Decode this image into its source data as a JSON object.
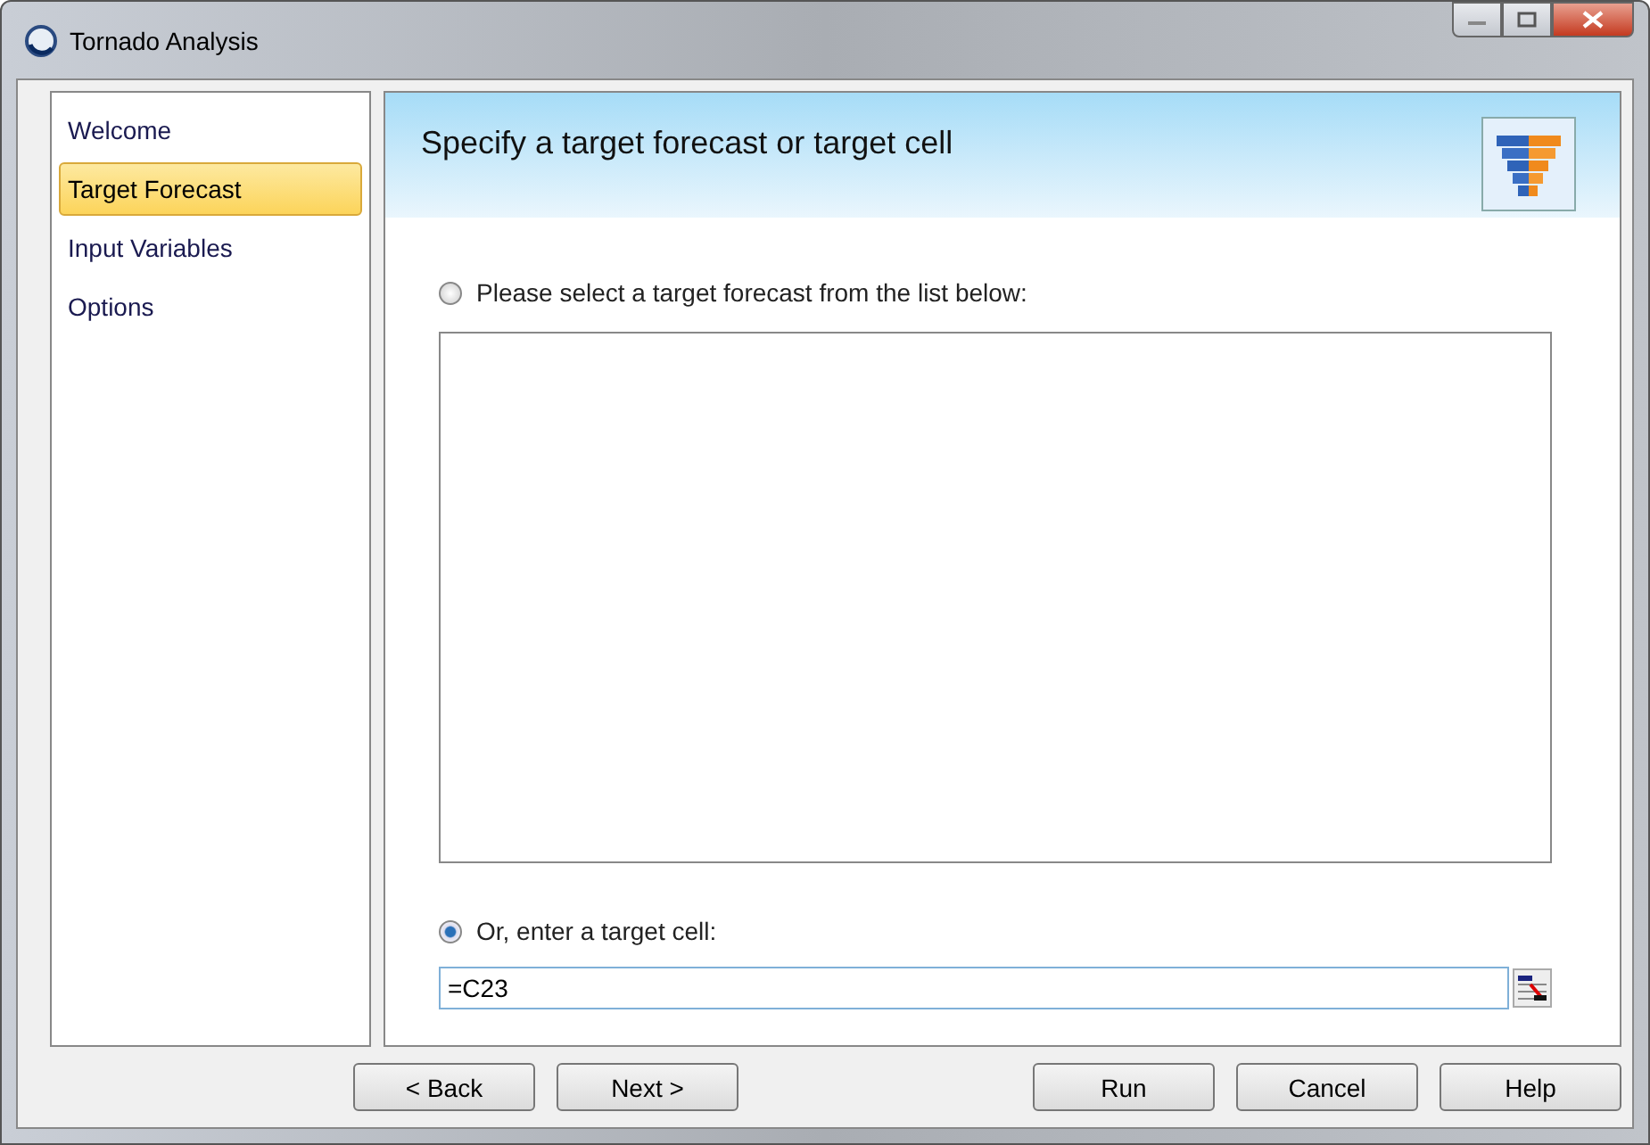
{
  "window": {
    "title": "Tornado Analysis"
  },
  "sidebar": {
    "items": [
      {
        "label": "Welcome",
        "selected": false
      },
      {
        "label": "Target Forecast",
        "selected": true
      },
      {
        "label": "Input Variables",
        "selected": false
      },
      {
        "label": "Options",
        "selected": false
      }
    ]
  },
  "header": {
    "title": "Specify a target forecast or target cell"
  },
  "options": [
    {
      "label": "Please select a target forecast from the list below:",
      "selected": false,
      "kind": "list"
    },
    {
      "label": "Or, enter a target cell:",
      "selected": true,
      "kind": "cell"
    }
  ],
  "target_cell": {
    "value": "=C23"
  },
  "buttons": [
    "< Back",
    "Next >",
    "Run",
    "Cancel",
    "Help"
  ]
}
